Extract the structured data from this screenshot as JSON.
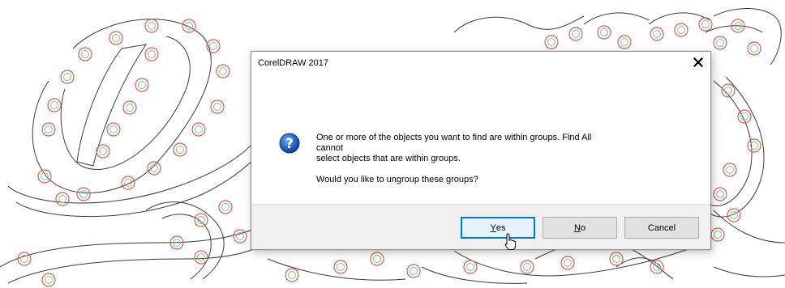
{
  "dialog": {
    "title": "CorelDRAW 2017",
    "close_symbol": "✕",
    "icon": "question-icon",
    "message_lines": [
      "One or more of the objects you want to find are within groups. Find All",
      "cannot",
      "select objects that are within groups."
    ],
    "question": "Would you like to ungroup these groups?",
    "buttons": {
      "yes": {
        "mnemonic": "Y",
        "rest": "es"
      },
      "no": {
        "mnemonic": "N",
        "rest": "o"
      },
      "cancel": "Cancel"
    }
  },
  "colors": {
    "accent": "#0078d7",
    "marker_outer": "#e05a5a",
    "marker_inner": "#7cc77c",
    "outline": "#3a3a3a"
  }
}
